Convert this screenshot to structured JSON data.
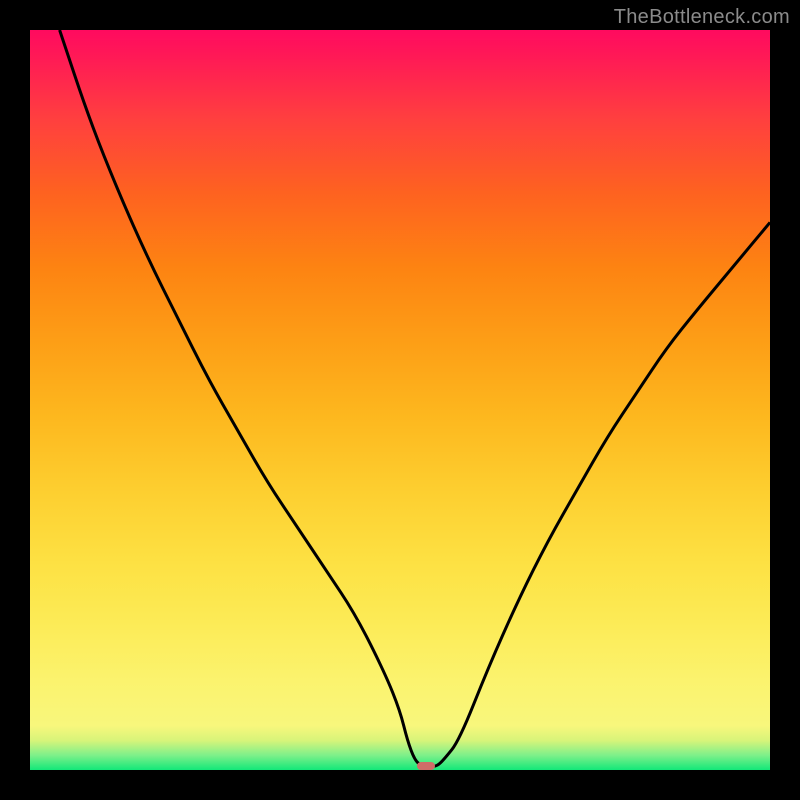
{
  "watermark": "TheBottleneck.com",
  "chart_data": {
    "type": "line",
    "title": "",
    "xlabel": "",
    "ylabel": "",
    "xlim": [
      0,
      100
    ],
    "ylim": [
      0,
      100
    ],
    "grid": false,
    "legend": false,
    "series": [
      {
        "name": "bottleneck-curve",
        "x": [
          4,
          8,
          12,
          16,
          20,
          24,
          28,
          32,
          36,
          40,
          44,
          48,
          50,
          51,
          52,
          53,
          54,
          55,
          56,
          58,
          62,
          66,
          70,
          74,
          78,
          82,
          86,
          90,
          95,
          100
        ],
        "y": [
          100,
          88,
          78,
          69,
          61,
          53,
          46,
          39,
          33,
          27,
          21,
          13,
          8,
          4,
          1.3,
          0.5,
          0.5,
          0.5,
          1.5,
          4,
          14,
          23,
          31,
          38,
          45,
          51,
          57,
          62,
          68,
          74
        ]
      }
    ],
    "marker": {
      "x": 53.5,
      "y": 0.5
    },
    "gradient_stops": [
      {
        "pos": 0,
        "color": "#12e879"
      },
      {
        "pos": 6,
        "color": "#f8f77c"
      },
      {
        "pos": 28,
        "color": "#fde143"
      },
      {
        "pos": 58,
        "color": "#fd9e16"
      },
      {
        "pos": 88,
        "color": "#ff3f3f"
      },
      {
        "pos": 100,
        "color": "#ff0a5f"
      }
    ]
  }
}
